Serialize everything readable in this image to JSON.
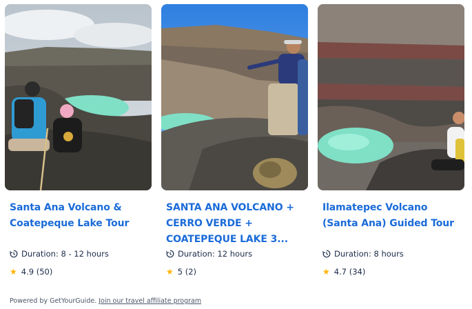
{
  "cards": [
    {
      "title": "Santa Ana Volcano & Coatepeque Lake Tour",
      "duration": "Duration: 8 - 12 hours",
      "rating": "4.9 (50)",
      "image_alt": "Hikers sitting at the rim of the Santa Ana volcano crater above a turquoise lake"
    },
    {
      "title": "SANTA ANA VOLCANO + CERRO VERDE + COATEPEQUE LAKE 3...",
      "duration": "Duration: 12 hours",
      "rating": "5 (2)",
      "image_alt": "Guide pointing across the crater while hikers stand on the volcano rim"
    },
    {
      "title": "Ilamatepec Volcano (Santa Ana) Guided Tour",
      "duration": "Duration: 8 hours",
      "rating": "4.7 (34)",
      "image_alt": "Turquoise crater lake inside Ilamatepec volcano with a hiker at the edge"
    }
  ],
  "footer": {
    "powered_by": "Powered by GetYourGuide.",
    "affiliate_link": "Join our travel affiliate program"
  },
  "colors": {
    "title_link": "#1a6bd8",
    "text": "#1a2b49",
    "star": "#ffb400",
    "crater_lake": "#7fe0c6"
  },
  "icons": {
    "duration": "clock-arrow-icon",
    "rating": "star-icon"
  }
}
